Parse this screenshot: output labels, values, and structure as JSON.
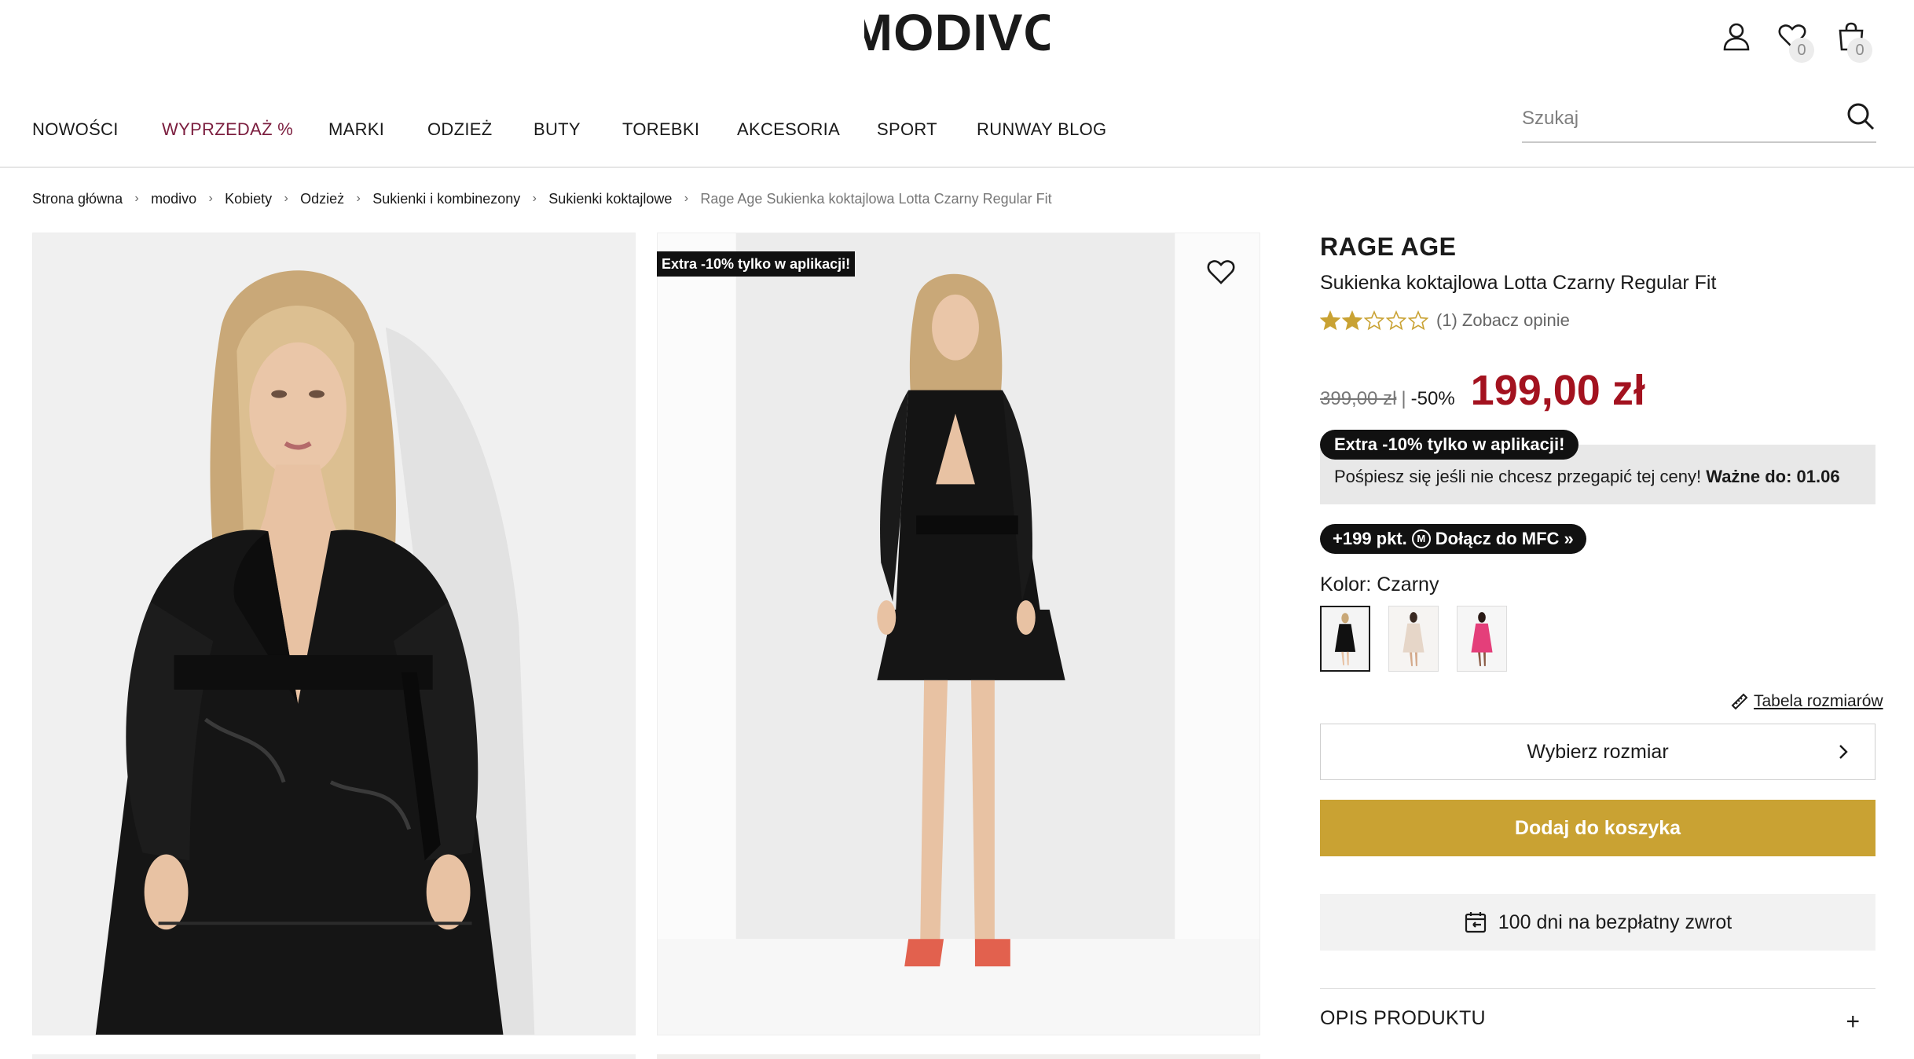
{
  "header": {
    "logo": "MODIVO",
    "wishlist_count": "0",
    "cart_count": "0",
    "icons": [
      "user-icon",
      "heart-icon",
      "bag-icon"
    ]
  },
  "nav": {
    "items": [
      {
        "label": "NOWOŚCI"
      },
      {
        "label": "WYPRZEDAŻ %"
      },
      {
        "label": "MARKI"
      },
      {
        "label": "ODZIEŻ"
      },
      {
        "label": "BUTY"
      },
      {
        "label": "TOREBKI"
      },
      {
        "label": "AKCESORIA"
      },
      {
        "label": "SPORT"
      },
      {
        "label": "RUNWAY BLOG"
      }
    ]
  },
  "search": {
    "placeholder": "Szukaj"
  },
  "breadcrumb": {
    "items": [
      {
        "label": "Strona główna"
      },
      {
        "label": "modivo"
      },
      {
        "label": "Kobiety"
      },
      {
        "label": "Odzież"
      },
      {
        "label": "Sukienki i kombinezony"
      },
      {
        "label": "Sukienki koktajlowe"
      }
    ],
    "current": "Rage Age Sukienka koktajlowa Lotta Czarny Regular Fit"
  },
  "gallery": {
    "promo_tag": "Extra -10% tylko w aplikacji!"
  },
  "product": {
    "brand": "RAGE AGE",
    "name": "Sukienka koktajlowa Lotta Czarny Regular Fit",
    "rating": {
      "value": 2,
      "max": 5,
      "count_label": "(1)",
      "link_label": "Zobacz opinie"
    },
    "price": {
      "old": "399,00 zł",
      "separator": "|",
      "discount": "-50%",
      "current": "199,00 zł"
    },
    "promo": {
      "pill": "Extra -10% tylko w aplikacji!",
      "text": "Pośpiesz się jeśli nie chcesz przegapić tej ceny!",
      "valid_label": "Ważne do: 01.06"
    },
    "mfc": {
      "points": "+199 pkt.",
      "badge": "M",
      "label": "Dołącz do MFC"
    },
    "color": {
      "label": "Kolor: Czarny",
      "swatches": [
        {
          "name": "Czarny",
          "color": "#1a1a1a",
          "selected": true
        },
        {
          "name": "Beżowy",
          "color": "#e6d6c8",
          "selected": false
        },
        {
          "name": "Różowy",
          "color": "#e43f7a",
          "selected": false
        }
      ]
    },
    "size_table_label": "Tabela rozmiarów",
    "size_select_label": "Wybierz rozmiar",
    "add_to_cart_label": "Dodaj do koszyka",
    "returns_label": "100 dni na bezpłatny zwrot",
    "description_title": "OPIS PRODUKTU",
    "description_toggle": "+"
  },
  "colors": {
    "sale_nav": "#7b1d3e",
    "price": "#a3121f",
    "add_to_cart": "#c9a233",
    "star": "#c9a233"
  }
}
